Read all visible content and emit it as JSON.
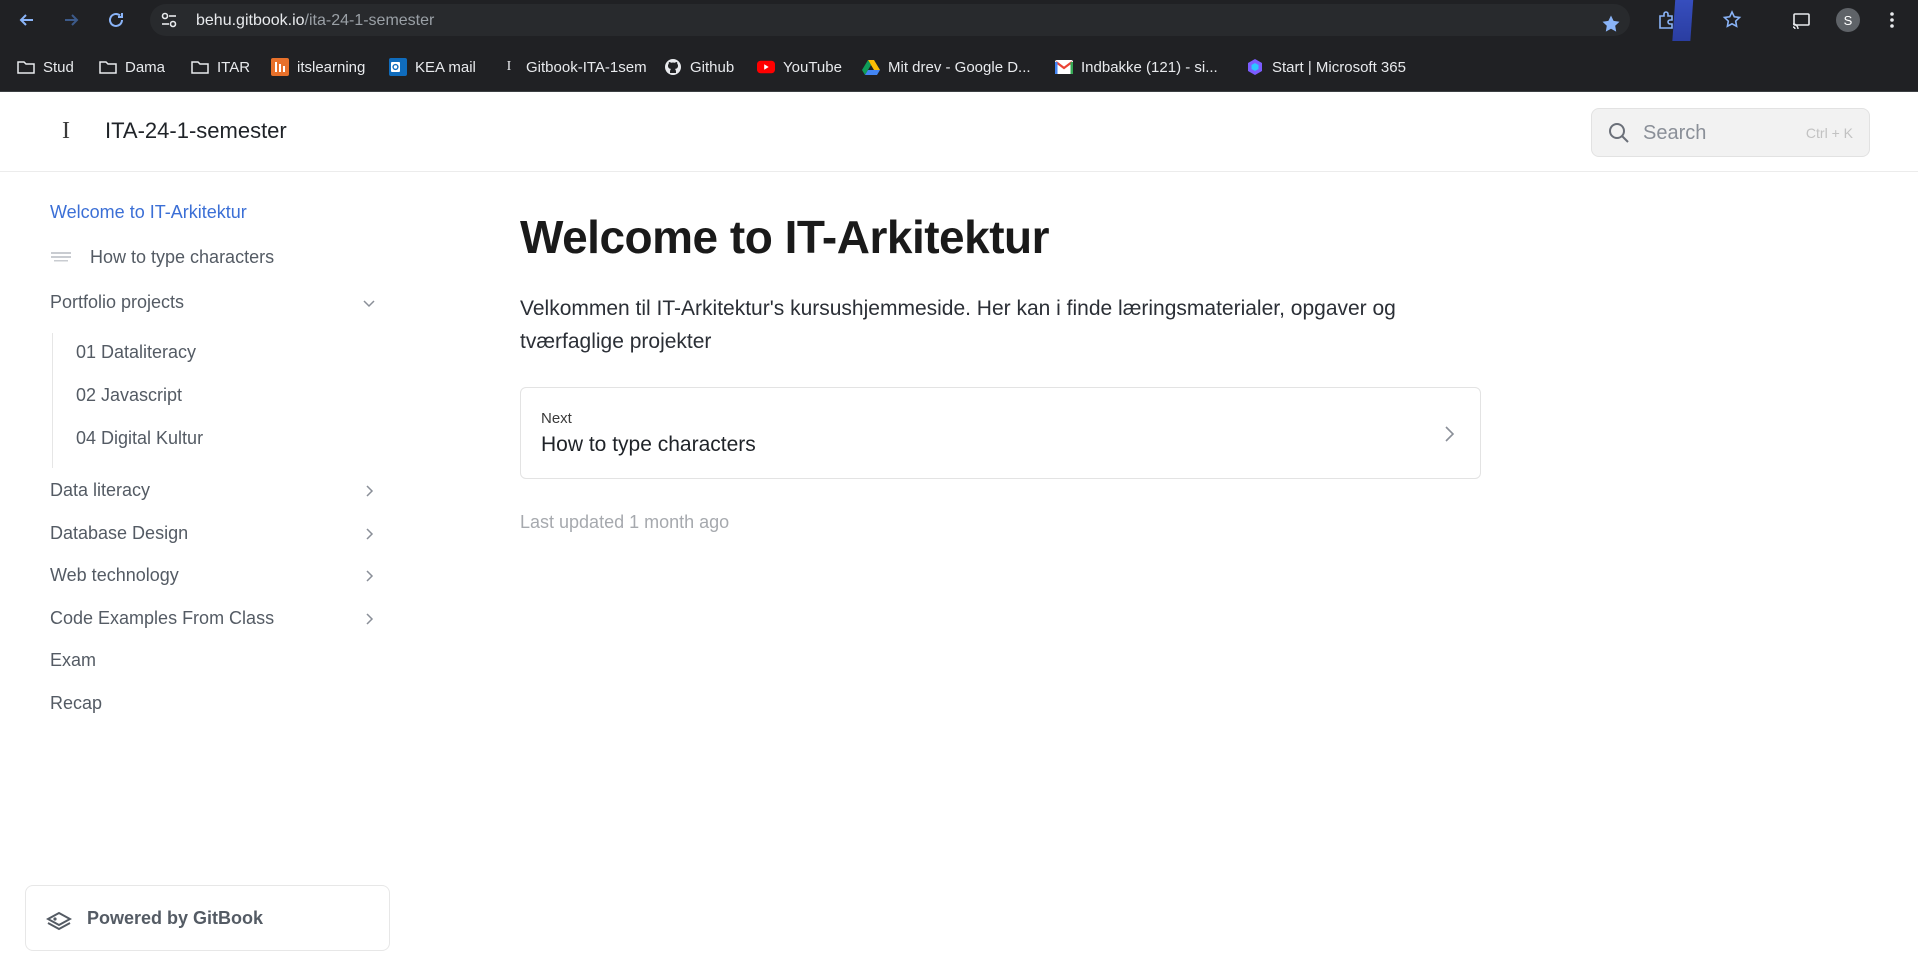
{
  "browser": {
    "url_host": "behu.gitbook.io",
    "url_path": "/ita-24-1-semester",
    "profile_initial": "S"
  },
  "bookmarks": [
    {
      "label": "Stud",
      "icon": "folder-icon"
    },
    {
      "label": "Dama",
      "icon": "folder-icon"
    },
    {
      "label": "ITAR",
      "icon": "folder-icon"
    },
    {
      "label": "itslearning",
      "icon": "itslearning-icon"
    },
    {
      "label": "KEA mail",
      "icon": "outlook-icon"
    },
    {
      "label": "Gitbook-ITA-1sem",
      "icon": "gitbook-icon"
    },
    {
      "label": "Github",
      "icon": "github-icon"
    },
    {
      "label": "YouTube",
      "icon": "youtube-icon"
    },
    {
      "label": "Mit drev - Google D...",
      "icon": "google-drive-icon"
    },
    {
      "label": "Indbakke (121) - si...",
      "icon": "gmail-icon"
    },
    {
      "label": "Start | Microsoft 365",
      "icon": "microsoft365-icon"
    }
  ],
  "header": {
    "logo_glyph": "I",
    "space_title": "ITA-24-1-semester",
    "search_placeholder": "Search",
    "search_shortcut": "Ctrl + K"
  },
  "sidebar": {
    "items": [
      {
        "label": "Welcome to IT-Arkitektur",
        "active": true
      },
      {
        "label": "How to type characters"
      },
      {
        "label": "Portfolio projects",
        "expanded": true
      },
      {
        "label": "01 Dataliteracy"
      },
      {
        "label": "02 Javascript"
      },
      {
        "label": "04 Digital Kultur"
      },
      {
        "label": "Data literacy"
      },
      {
        "label": "Database Design"
      },
      {
        "label": "Web technology"
      },
      {
        "label": "Code Examples From Class"
      },
      {
        "label": "Exam"
      },
      {
        "label": "Recap"
      }
    ],
    "powered_by": "Powered by GitBook"
  },
  "main": {
    "title": "Welcome to IT-Arkitektur",
    "description": "Velkommen til IT-Arkitektur's kursushjemmeside. Her kan i finde læringsmaterialer, opgaver og tværfaglige projekter",
    "next_label": "Next",
    "next_title": "How to type characters",
    "last_updated": "Last updated 1 month ago"
  },
  "colors": {
    "accent": "#3b6fd6",
    "chrome_bg": "#202124"
  }
}
